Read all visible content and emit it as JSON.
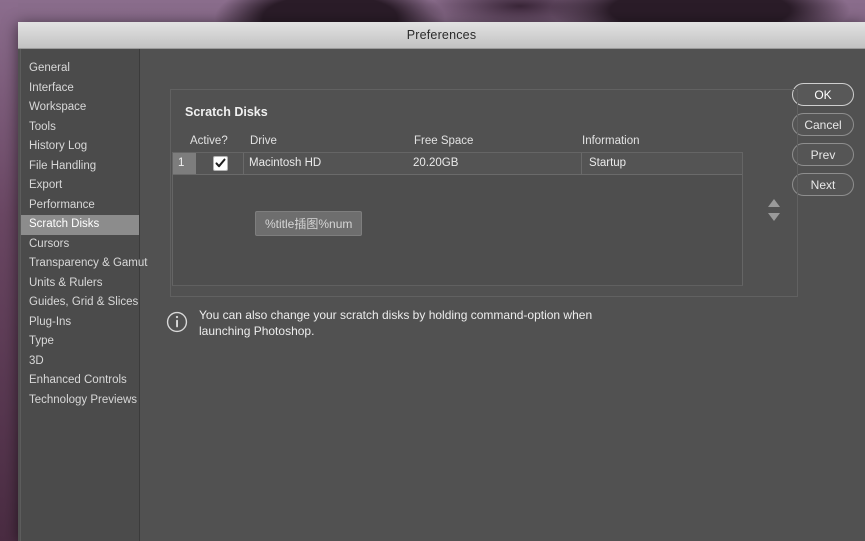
{
  "window": {
    "title": "Preferences"
  },
  "sidebar": {
    "items": [
      {
        "label": "General",
        "selected": false
      },
      {
        "label": "Interface",
        "selected": false
      },
      {
        "label": "Workspace",
        "selected": false
      },
      {
        "label": "Tools",
        "selected": false
      },
      {
        "label": "History Log",
        "selected": false
      },
      {
        "label": "File Handling",
        "selected": false
      },
      {
        "label": "Export",
        "selected": false
      },
      {
        "label": "Performance",
        "selected": false
      },
      {
        "label": "Scratch Disks",
        "selected": true
      },
      {
        "label": "Cursors",
        "selected": false
      },
      {
        "label": "Transparency & Gamut",
        "selected": false
      },
      {
        "label": "Units & Rulers",
        "selected": false
      },
      {
        "label": "Guides, Grid & Slices",
        "selected": false
      },
      {
        "label": "Plug-Ins",
        "selected": false
      },
      {
        "label": "Type",
        "selected": false
      },
      {
        "label": "3D",
        "selected": false
      },
      {
        "label": "Enhanced Controls",
        "selected": false
      },
      {
        "label": "Technology Previews",
        "selected": false
      }
    ]
  },
  "buttons": {
    "ok": "OK",
    "cancel": "Cancel",
    "prev": "Prev",
    "next": "Next"
  },
  "panel": {
    "group_label": "Scratch Disks",
    "columns": {
      "active": "Active?",
      "drive": "Drive",
      "free_space": "Free Space",
      "information": "Information"
    },
    "rows": [
      {
        "num": "1",
        "active": true,
        "drive": "Macintosh HD",
        "free_space": "20.20GB",
        "information": "Startup"
      }
    ],
    "token_label": "%title插图%num",
    "reorder_up": "▲",
    "reorder_down": "▼"
  },
  "note": {
    "icon": "info-icon",
    "text": "You can also change your scratch disks by holding command-option when launching Photoshop."
  },
  "colors": {
    "dialog_bg": "#515151",
    "sidebar_bg": "#4b4b4b",
    "selection": "#8c8c8c",
    "titlebar": "#d3d3d3",
    "desktop": "#6b4a63"
  }
}
